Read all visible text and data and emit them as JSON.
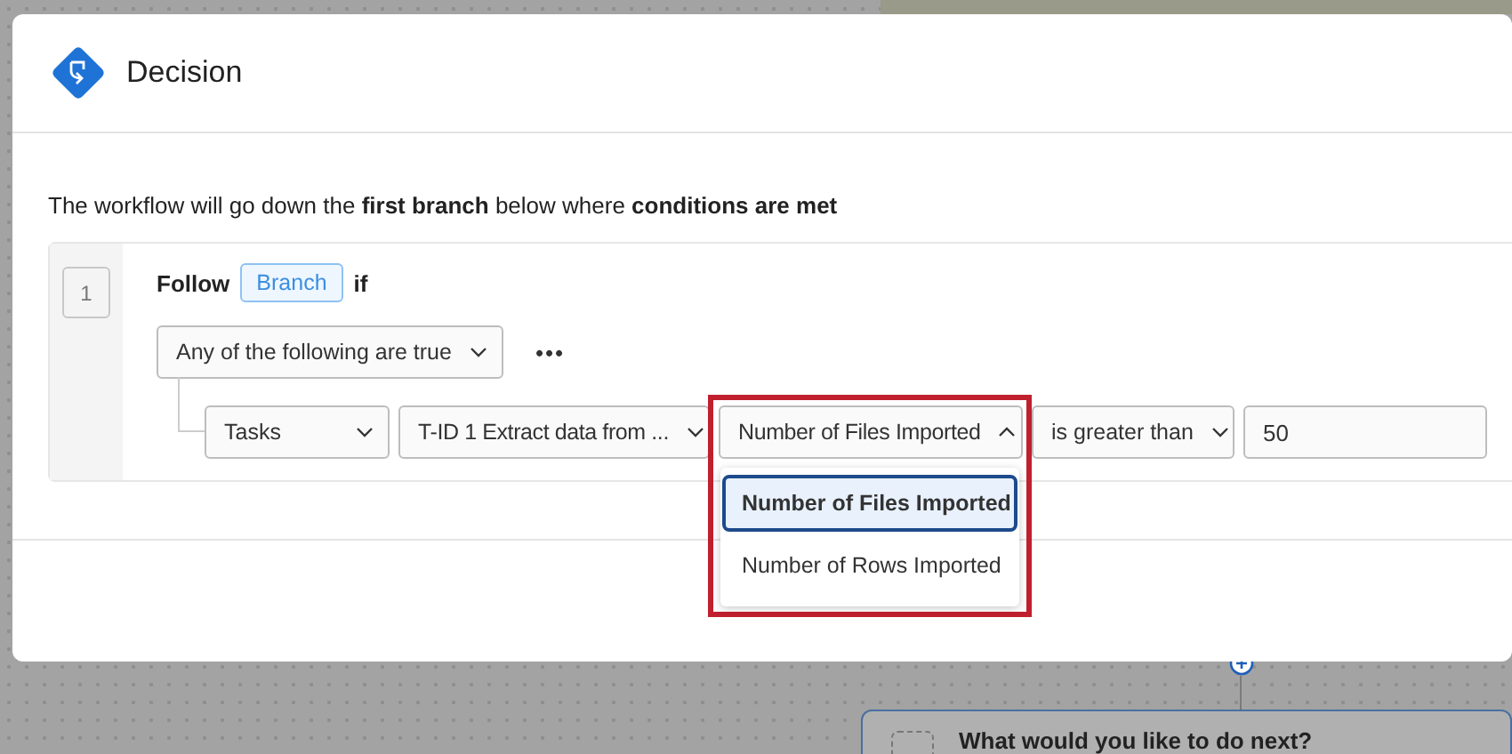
{
  "dialog": {
    "title": "Decision",
    "intro": "The workflow will go down the **first branch** below where **conditions are met**"
  },
  "branch": {
    "number": "1",
    "follow_label": "Follow",
    "tag": "Branch",
    "if_label": "if",
    "group_select": "Any of the following are true",
    "more": "•••",
    "condition": [
      {
        "kind": "select",
        "value": "Tasks",
        "open": false,
        "highlighted": false
      },
      {
        "kind": "select",
        "value": "T-ID 1 Extract data from ...",
        "open": false,
        "highlighted": false
      },
      {
        "kind": "select",
        "value": "Number of Files Imported",
        "open": true,
        "highlighted": true,
        "options": [
          {
            "label": "Number of Files Imported",
            "selected": true
          },
          {
            "label": "Number of Rows Imported",
            "selected": false
          }
        ]
      },
      {
        "kind": "select",
        "value": "is greater than",
        "open": false,
        "highlighted": false
      },
      {
        "kind": "input",
        "value": "50"
      }
    ]
  },
  "canvas": {
    "next_card": "What would you like to do next?"
  }
}
